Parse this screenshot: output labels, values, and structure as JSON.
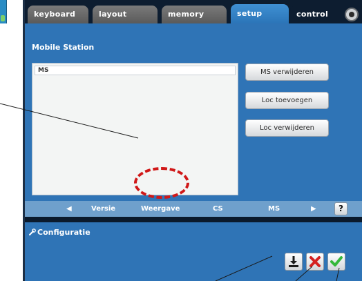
{
  "tabs": [
    {
      "label": "keyboard"
    },
    {
      "label": "layout"
    },
    {
      "label": "memory"
    },
    {
      "label": "setup"
    },
    {
      "label": "control"
    }
  ],
  "panel": {
    "title": "Mobile Station",
    "list_items": [
      "MS"
    ],
    "buttons": [
      "MS verwijderen",
      "Loc toevoegen",
      "Loc verwijderen"
    ]
  },
  "nav": {
    "prev_arrow": "◀",
    "items": [
      "Versie",
      "Weergave",
      "CS",
      "MS"
    ],
    "next_arrow": "▶",
    "help_label": "?"
  },
  "config": {
    "title": "Configuratie"
  },
  "icons": {
    "control": "stop-icon",
    "config": "wrench-icon",
    "actions": [
      "download-icon",
      "cancel-icon",
      "confirm-icon"
    ]
  },
  "colors": {
    "active_tab": "#3f90d4",
    "panel": "#2f74b6",
    "highlight": "#d01818",
    "cancel": "#d52020",
    "confirm": "#35b83a"
  }
}
